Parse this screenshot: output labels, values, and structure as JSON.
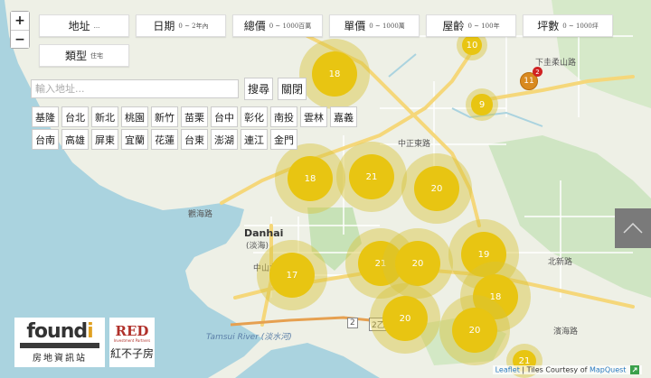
{
  "colors": {
    "cluster_core": "#e8c512",
    "cluster_halo": "#d6c43c",
    "pin": "#d98a20",
    "badge": "#d02222",
    "link": "#2a7ac0",
    "sea": "#aad3df"
  },
  "zoom": {
    "in_label": "+",
    "out_label": "−"
  },
  "filters": [
    {
      "label": "地址",
      "sub": "..."
    },
    {
      "label": "日期",
      "sub": "0 ~ 2年內"
    },
    {
      "label": "總價",
      "sub": "0 ~ 1000百萬"
    },
    {
      "label": "單價",
      "sub": "0 ~ 1000萬"
    },
    {
      "label": "屋齡",
      "sub": "0 ~ 100年"
    },
    {
      "label": "坪數",
      "sub": "0 ~ 1000坪"
    },
    {
      "label": "類型",
      "sub": "住宅"
    }
  ],
  "search": {
    "placeholder": "輸入地址...",
    "search_label": "搜尋",
    "close_label": "關閉"
  },
  "regions": [
    "基隆",
    "台北",
    "新北",
    "桃園",
    "新竹",
    "苗栗",
    "台中",
    "彰化",
    "南投",
    "雲林",
    "嘉義",
    "台南",
    "高雄",
    "屏東",
    "宜蘭",
    "花蓮",
    "台東",
    "澎湖",
    "連江",
    "金門"
  ],
  "clusters": [
    {
      "count": "10"
    },
    {
      "count": "18"
    },
    {
      "count": "9"
    },
    {
      "count": "18"
    },
    {
      "count": "21"
    },
    {
      "count": "20"
    },
    {
      "count": "21"
    },
    {
      "count": "20"
    },
    {
      "count": "19"
    },
    {
      "count": "17"
    },
    {
      "count": "18"
    },
    {
      "count": "20"
    },
    {
      "count": "20"
    },
    {
      "count": "21"
    }
  ],
  "pin": {
    "count": "11",
    "badge": "2"
  },
  "map_labels": {
    "danhai": "Danhai",
    "danhai_cn": "(淡海)",
    "tamsui_river": "Tamsui River (淡水河)",
    "road_guanhai": "觀海路",
    "road_bin": "濱海路",
    "road_zhongzheng": "中正東路",
    "road_xiazhang": "下圭柔山路",
    "road_beixin": "北新路",
    "road_zhongshan": "中山北路",
    "shield_2": "2",
    "shield_2b": "2乙"
  },
  "logos": {
    "foundi_word_a": "found",
    "foundi_word_b": "i",
    "foundi_cn": "房地資訊站",
    "red_word": "RED",
    "red_small": "Investment Partners",
    "red_cn": "紅不子房"
  },
  "attribution": {
    "leaflet": "Leaflet",
    "tiles": " | Tiles Courtesy of ",
    "mapquest": "MapQuest"
  },
  "icons": {
    "up": "chevron-up-icon",
    "external": "external-link-icon"
  }
}
